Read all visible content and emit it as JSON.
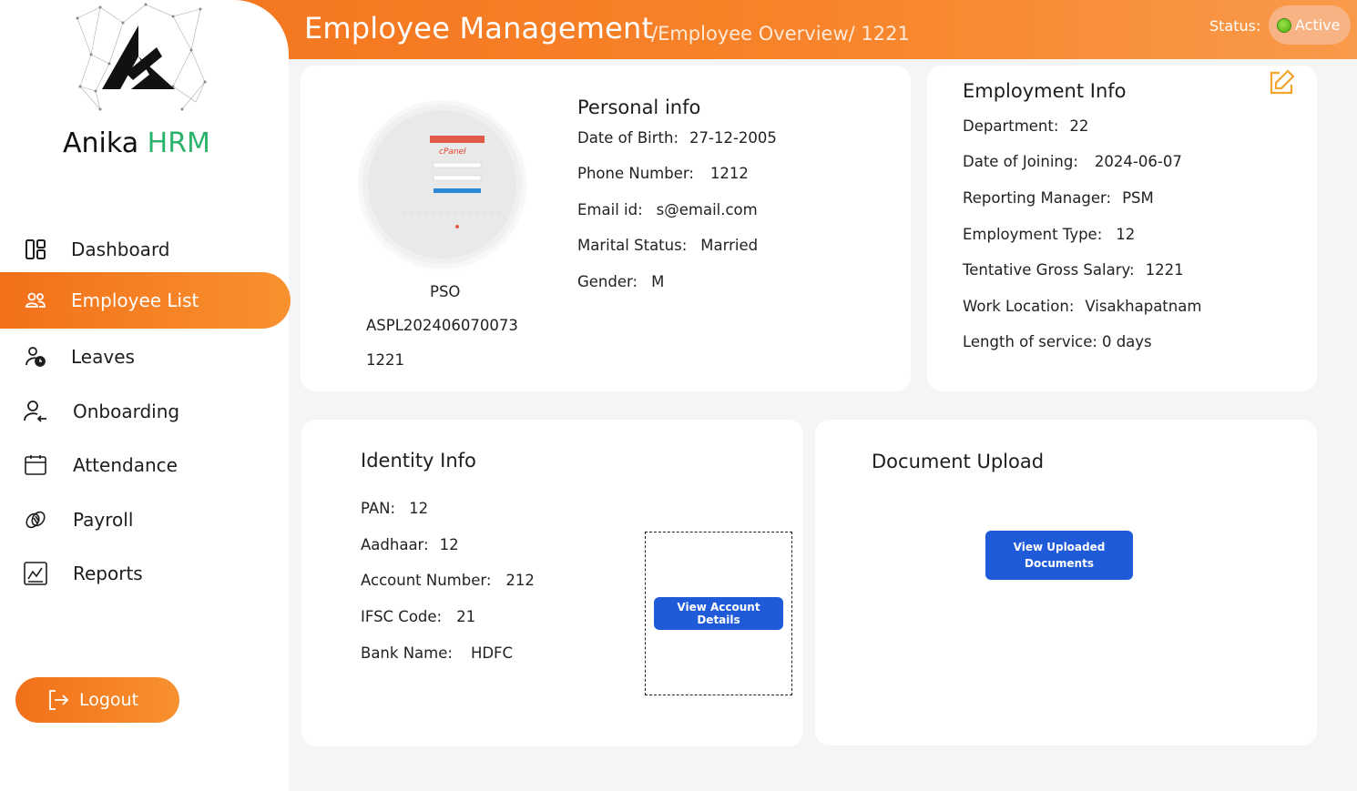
{
  "header": {
    "title": "Employee Management",
    "breadcrumb": "/Employee Overview/ 1221",
    "status_label": "Status:",
    "status_value": "Active",
    "accent": "#f3721c"
  },
  "brand": {
    "name_part1": "Anika",
    "name_part2": "HRM",
    "accent": "#2bb36b"
  },
  "sidebar": {
    "items": [
      {
        "label": "Dashboard",
        "icon": "dashboard-icon"
      },
      {
        "label": "Employee List",
        "icon": "users-icon",
        "active": true
      },
      {
        "label": "Leaves",
        "icon": "user-clock-icon"
      },
      {
        "label": "Onboarding",
        "icon": "user-arrow-icon"
      },
      {
        "label": "Attendance",
        "icon": "calendar-icon"
      },
      {
        "label": "Payroll",
        "icon": "coins-icon"
      },
      {
        "label": "Reports",
        "icon": "report-chart-icon"
      }
    ],
    "logout_label": "Logout"
  },
  "profile": {
    "role": "PSO",
    "employee_code": "ASPL202406070073",
    "employee_id": "1221"
  },
  "personal": {
    "title": "Personal info",
    "dob_label": "Date of Birth:",
    "dob": "27-12-2005",
    "phone_label": "Phone Number:",
    "phone": "1212",
    "email_label": "Email id:",
    "email": "s@email.com",
    "marital_label": "Marital Status:",
    "marital": "Married",
    "gender_label": "Gender:",
    "gender": "M"
  },
  "employment": {
    "title": "Employment Info",
    "department_label": "Department:",
    "department": "22",
    "doj_label": "Date of Joining:",
    "doj": "2024-06-07",
    "manager_label": "Reporting Manager:",
    "manager": "PSM",
    "type_label": "Employment Type:",
    "type": "12",
    "salary_label": "Tentative Gross Salary:",
    "salary": "1221",
    "location_label": "Work Location:",
    "location": "Visakhapatnam",
    "service_label": "Length of service:",
    "service": "0 days"
  },
  "identity": {
    "title": "Identity Info",
    "pan_label": "PAN:",
    "pan": "12",
    "aadhaar_label": "Aadhaar:",
    "aadhaar": "12",
    "account_label": "Account Number:",
    "account": "212",
    "ifsc_label": "IFSC Code:",
    "ifsc": "21",
    "bank_label": "Bank Name:",
    "bank": "HDFC",
    "view_account_button": "View Account Details"
  },
  "documents": {
    "title": "Document Upload",
    "view_button_line1": "View Uploaded",
    "view_button_line2": "Documents"
  }
}
